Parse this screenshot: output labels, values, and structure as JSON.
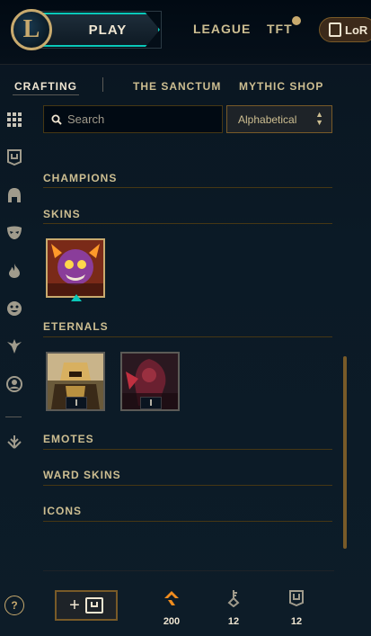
{
  "header": {
    "logo_letter": "L",
    "play_label": "PLAY",
    "nav": [
      {
        "label": "LEAGUE"
      },
      {
        "label": "TFT"
      }
    ],
    "lor_label": "LoR"
  },
  "subnav": {
    "items": [
      {
        "label": "CRAFTING",
        "active": true
      },
      {
        "label": "THE SANCTUM",
        "active": false
      },
      {
        "label": "MYTHIC SHOP",
        "active": false
      }
    ]
  },
  "sidebar": {
    "icons": [
      "grid-icon",
      "chest-icon",
      "helmet-icon",
      "mask-icon",
      "flame-icon",
      "emote-face-icon",
      "ward-icon",
      "profile-icon",
      "arrow-down-icon"
    ],
    "help_label": "?"
  },
  "search": {
    "placeholder": "Search",
    "value": ""
  },
  "sort": {
    "selected": "Alphabetical"
  },
  "sections": [
    {
      "title": "CHAMPIONS"
    },
    {
      "title": "SKINS"
    },
    {
      "title": "ETERNALS"
    },
    {
      "title": "EMOTES"
    },
    {
      "title": "WARD SKINS"
    },
    {
      "title": "ICONS"
    }
  ],
  "eternals": [
    {
      "badge": "I"
    },
    {
      "badge": "I"
    }
  ],
  "footer": {
    "add_label": "+",
    "currencies": [
      {
        "icon": "orange-essence-icon",
        "value": "200"
      },
      {
        "icon": "key-icon",
        "value": "12"
      },
      {
        "icon": "chest-icon",
        "value": "12"
      }
    ]
  },
  "colors": {
    "gold": "#c8aa6e",
    "teal_accent": "#0ac8b9",
    "orange_essence": "#f08c1e",
    "background": "#0b1a26"
  }
}
